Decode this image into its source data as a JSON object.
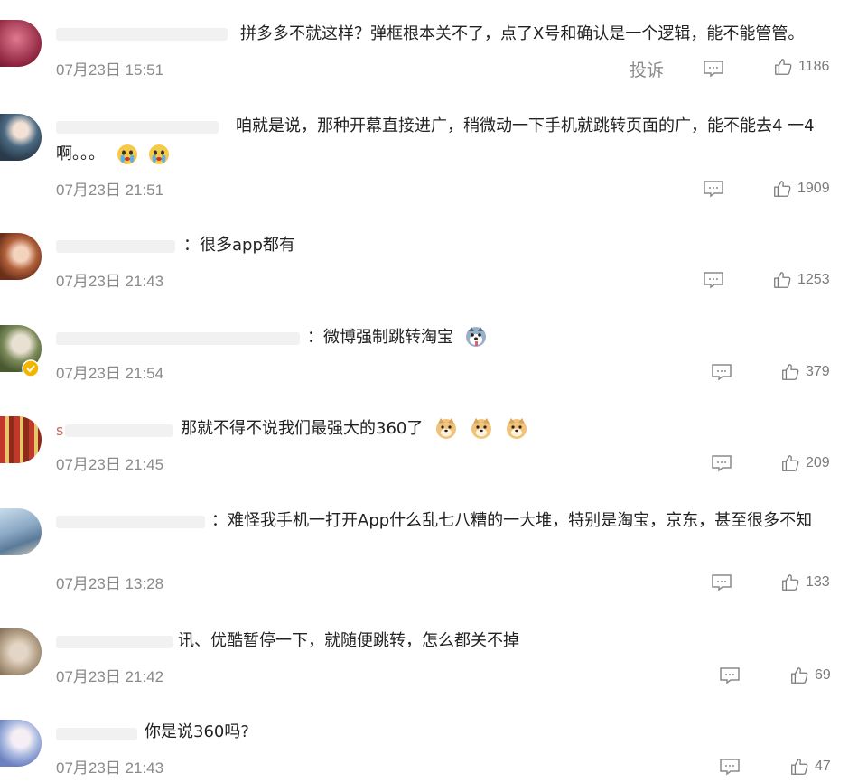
{
  "report_label": "投诉",
  "comments": [
    {
      "text": "拼多多不就这样？弹框根本关不了，点了X号和确认是一个逻辑，能不能管管。",
      "time": "07月23日 15:51",
      "likes": "1186",
      "avatar_color": "#c23d5a"
    },
    {
      "text": "咱就是说，那种开幕直接进广，稍微动一下手机就跳转页面的广，能不能去4 一4",
      "text_line2": "啊。。。",
      "time": "07月23日 21:51",
      "likes": "1909",
      "avatar_color": "#3e5a70"
    },
    {
      "text": "：很多app都有",
      "time": "07月23日 21:43",
      "likes": "1253",
      "avatar_color": "#a0532f"
    },
    {
      "text": "：微博强制跳转淘宝",
      "time": "07月23日 21:54",
      "likes": "379",
      "avatar_color": "#6c7a52"
    },
    {
      "text": "那就不得不说我们最强大的360了",
      "time": "07月23日 21:45",
      "likes": "209",
      "avatar_color": "#9c3a28"
    },
    {
      "text": "：难怪我手机一打开App什么乱七八糟的一大堆，特别是淘宝，京东，甚至很多不知",
      "time": "07月23日 13:28",
      "likes": "133",
      "avatar_color": "#6a8aa8"
    },
    {
      "text": "讯、优酷暂停一下，就随便跳转，怎么都关不掉",
      "time": "07月23日 21:42",
      "likes": "69",
      "avatar_color": "#b8a896"
    },
    {
      "text": "你是说360吗?",
      "time": "07月23日 21:43",
      "likes": "47",
      "avatar_color": "#9fb0d8"
    }
  ]
}
